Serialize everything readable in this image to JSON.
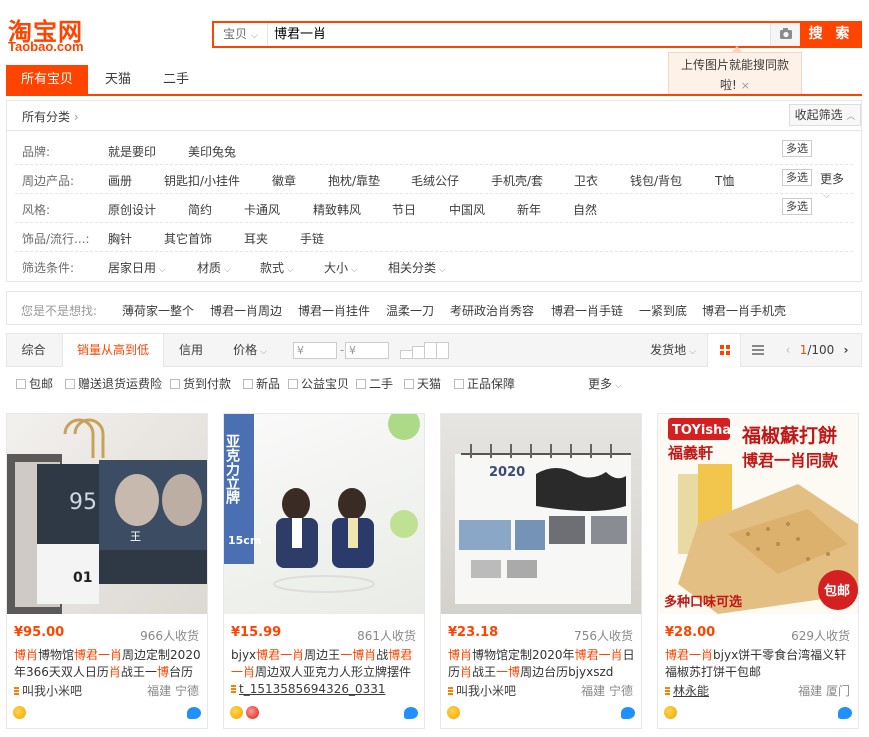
{
  "logo": {
    "cn": "淘宝网",
    "en": "Taobao.com"
  },
  "search": {
    "scope": "宝贝",
    "query": "博君一肖",
    "button": "搜 索"
  },
  "tip": {
    "line1": "上传图片就能搜同款",
    "line2": "啦!",
    "close": "×"
  },
  "tabs": [
    "所有宝贝",
    "天猫",
    "二手"
  ],
  "breadcrumb": {
    "label": "所有分类",
    "sep": "›",
    "collapse": "收起筛选"
  },
  "filters": {
    "brand": {
      "label": "品牌:",
      "values": [
        "就是要印",
        "美印兔兔"
      ],
      "multi": "多选"
    },
    "peripheral": {
      "label": "周边产品:",
      "values": [
        "画册",
        "钥匙扣/小挂件",
        "徽章",
        "抱枕/靠垫",
        "毛绒公仔",
        "手机壳/套",
        "卫衣",
        "钱包/背包",
        "T恤"
      ],
      "multi": "多选",
      "more": "更多"
    },
    "style": {
      "label": "风格:",
      "values": [
        "原创设计",
        "简约",
        "卡通风",
        "精致韩风",
        "节日",
        "中国风",
        "新年",
        "自然"
      ],
      "multi": "多选"
    },
    "jewelry": {
      "label": "饰品/流行...:",
      "values": [
        "胸针",
        "其它首饰",
        "耳夹",
        "手链"
      ]
    },
    "conditions": {
      "label": "筛选条件:",
      "values": [
        "居家日用",
        "材质",
        "款式",
        "大小",
        "相关分类"
      ]
    }
  },
  "suggest": {
    "label": "您是不是想找:",
    "items": [
      "薄荷家一整个",
      "博君一肖周边",
      "博君一肖挂件",
      "温柔一刀",
      "考研政治肖秀容",
      "博君一肖手链",
      "一紧到底",
      "博君一肖手机壳"
    ]
  },
  "sort": {
    "items": [
      "综合",
      "销量从高到低",
      "信用",
      "价格"
    ],
    "price_from": "¥",
    "price_to": "¥",
    "dash": "-",
    "ship_from": "发货地",
    "page_current": "1",
    "page_total": "/100"
  },
  "options": {
    "items": [
      "包邮",
      "赠送退货运费险",
      "货到付款",
      "新品",
      "公益宝贝",
      "二手",
      "天猫",
      "正品保障"
    ],
    "more": "更多"
  },
  "products": [
    {
      "price": "¥95.00",
      "sales": "966人收货",
      "title_parts": [
        [
          "博肖",
          true
        ],
        [
          "博物馆",
          false
        ],
        [
          "博君一肖",
          true
        ],
        [
          "周边定制2020年366天双人日历",
          false
        ],
        [
          "肖",
          true
        ],
        [
          "战王一",
          false
        ],
        [
          "博",
          true
        ],
        [
          "台历",
          false
        ]
      ],
      "shop": "叫我小米吧",
      "location": "福建 宁德"
    },
    {
      "price": "¥15.99",
      "sales": "861人收货",
      "title_parts": [
        [
          "bjyx",
          false
        ],
        [
          "博君一肖",
          true
        ],
        [
          "周边王",
          false
        ],
        [
          "一博",
          true
        ],
        [
          "肖",
          true
        ],
        [
          "战",
          false
        ],
        [
          "博君一肖",
          true
        ],
        [
          "周边双人亚克力人形立牌摆件",
          false
        ]
      ],
      "shop": "t_1513585694326_0331",
      "location": ""
    },
    {
      "price": "¥23.18",
      "sales": "756人收货",
      "title_parts": [
        [
          "博肖",
          true
        ],
        [
          "博物馆定制2020年",
          false
        ],
        [
          "博君一肖",
          true
        ],
        [
          "日历",
          false
        ],
        [
          "肖",
          true
        ],
        [
          "战王",
          false
        ],
        [
          "一博",
          true
        ],
        [
          "周边台历bjyxszd",
          false
        ]
      ],
      "shop": "叫我小米吧",
      "location": "福建 宁德"
    },
    {
      "price": "¥28.00",
      "sales": "629人收货",
      "title_parts": [
        [
          "博君一肖",
          true
        ],
        [
          "bjyx饼干零食台湾福义轩福椒苏打饼干包邮",
          false
        ]
      ],
      "shop": "林永能",
      "location": "福建 厦门"
    }
  ],
  "image_texts": {
    "p1_date": "01",
    "p1_tag": "王",
    "p2_vertical": "亚克力立牌",
    "p2_size": "15cm",
    "p3_year": "2020",
    "p4_brand": "TOYishan",
    "p4_cn": "福義軒",
    "p4_head": "福椒蘇打餅",
    "p4_sub": "博君一肖同款",
    "p4_flavor": "多种口味可选",
    "p4_ship": "包邮"
  },
  "colors": {
    "accent": "#ff4400",
    "border": "#e6e6e6"
  }
}
